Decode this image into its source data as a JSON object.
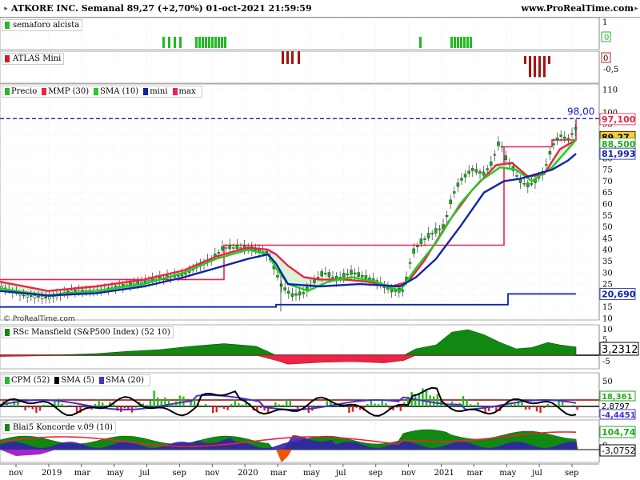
{
  "header": {
    "title": "ATKORE INC. Semanal 89,27 (+2,70%) 01-oct-2021 21:59:59",
    "site": "www.ProRealTime.com"
  },
  "copyright": "© ProRealTime.com",
  "colors": {
    "up": "#22bb22",
    "down": "#cc2222",
    "mmp": "#ee2244",
    "sma": "#22cc22",
    "mini": "#1122aa",
    "max": "#ee2255",
    "bg": "#ffffff"
  },
  "x_axis": [
    "nov",
    "2019",
    "mar",
    "may",
    "jul",
    "sep",
    "nov",
    "2020",
    "mar",
    "may",
    "jul",
    "sep",
    "nov",
    "2021",
    "mar",
    "may",
    "jul",
    "sep"
  ],
  "chart_data": [
    {
      "name": "semaforo",
      "type": "bar",
      "legend": "semaforo alcista",
      "ylim": [
        0,
        1
      ],
      "y_ticks": [
        "1",
        "0"
      ],
      "value_label": "0",
      "green_bars_x": [
        203,
        210,
        217,
        224,
        244,
        248,
        252,
        256,
        260,
        264,
        268,
        272,
        276,
        280,
        524,
        563,
        567,
        571,
        575,
        579,
        583,
        587
      ],
      "red_bars_x": [
        352,
        358,
        364,
        372
      ]
    },
    {
      "name": "atlas",
      "type": "bar",
      "legend": "ATLAS Mini",
      "ylim": [
        -1,
        0
      ],
      "y_ticks": [
        "0",
        "-0,5"
      ],
      "value_label": "0",
      "bars_x": [
        655,
        661,
        667,
        673,
        679,
        685
      ],
      "bars_val": [
        -0.3,
        -0.8,
        -0.8,
        -0.8,
        -0.8,
        -0.3
      ]
    },
    {
      "name": "price",
      "type": "line",
      "legend": [
        {
          "label": "Precio",
          "color": "#22bb22"
        },
        {
          "label": "MMP (30)",
          "color": "#ee2244"
        },
        {
          "label": "SMA (10)",
          "color": "#22cc22"
        },
        {
          "label": "mini",
          "color": "#1122aa"
        },
        {
          "label": "max",
          "color": "#ee2255"
        }
      ],
      "ylim": [
        10,
        110
      ],
      "y_ticks": [
        110,
        100,
        95,
        90,
        85,
        80,
        75,
        70,
        65,
        60,
        55,
        50,
        45,
        40,
        35,
        30,
        25,
        20,
        15,
        10
      ],
      "level_98": "98,00",
      "labels": [
        {
          "text": "97,100",
          "color": "#ee2244",
          "bg": "#ffffff",
          "y": 97.1
        },
        {
          "text": "89,27",
          "color": "#000000",
          "bg": "#ffcc33",
          "y": 89.27
        },
        {
          "text": "88,500",
          "color": "#22aa22",
          "bg": "#ffffff",
          "y": 86.3
        },
        {
          "text": "81,993",
          "color": "#1122aa",
          "bg": "#ffffff",
          "y": 81.99
        },
        {
          "text": "20,690",
          "color": "#1122aa",
          "bg": "#ffffff",
          "y": 20.69
        }
      ],
      "price_x": [
        0,
        30,
        60,
        90,
        120,
        150,
        180,
        210,
        230,
        250,
        265,
        280,
        300,
        320,
        335,
        345,
        352,
        365,
        380,
        395,
        405,
        420,
        440,
        455,
        470,
        490,
        505,
        515,
        525,
        540,
        555,
        565,
        575,
        590,
        605,
        615,
        625,
        632,
        640,
        650,
        660,
        670,
        680,
        690,
        700,
        710,
        720
      ],
      "price_y": [
        24,
        20,
        19,
        22,
        22,
        24,
        26,
        28,
        29,
        33,
        36,
        41,
        41,
        40,
        38,
        30,
        24,
        20,
        21,
        27,
        30,
        27,
        30,
        28,
        26,
        22,
        22,
        38,
        43,
        47,
        50,
        63,
        70,
        75,
        73,
        78,
        88,
        80,
        76,
        70,
        68,
        70,
        74,
        85,
        90,
        88,
        93
      ],
      "mmp_x": [
        0,
        60,
        120,
        180,
        230,
        270,
        310,
        335,
        345,
        360,
        380,
        400,
        430,
        460,
        490,
        510,
        530,
        560,
        590,
        620,
        640,
        660,
        680,
        700,
        720
      ],
      "mmp_y": [
        26,
        22,
        24,
        27,
        31,
        37,
        41,
        40,
        38,
        33,
        28,
        27,
        27,
        26,
        24,
        26,
        35,
        52,
        66,
        77,
        78,
        72,
        73,
        84,
        88
      ],
      "sma_x": [
        0,
        60,
        120,
        180,
        230,
        270,
        310,
        335,
        345,
        360,
        385,
        410,
        440,
        470,
        500,
        520,
        545,
        575,
        600,
        625,
        645,
        665,
        690,
        710,
        720
      ],
      "sma_y": [
        23,
        20,
        22,
        25,
        30,
        36,
        40,
        38,
        32,
        25,
        22,
        26,
        28,
        26,
        22,
        32,
        43,
        60,
        70,
        76,
        75,
        70,
        76,
        84,
        88
      ],
      "mini_x": [
        0,
        60,
        120,
        180,
        230,
        270,
        310,
        335,
        345,
        360,
        400,
        450,
        500,
        520,
        545,
        575,
        605,
        630,
        650,
        670,
        690,
        710,
        720
      ],
      "mini_y": [
        22,
        20,
        21,
        24,
        28,
        32,
        36,
        38,
        34,
        25,
        24,
        25,
        24,
        28,
        36,
        50,
        65,
        70,
        71,
        73,
        75,
        79,
        82
      ],
      "max_steps_x": [
        0,
        60,
        280,
        345,
        630,
        690,
        720
      ],
      "max_steps_y": [
        27,
        27,
        42,
        42,
        85,
        88,
        97
      ],
      "min_steps_x": [
        0,
        60,
        345,
        635,
        720
      ],
      "min_steps_y": [
        15,
        15,
        16,
        20.69,
        20.69
      ]
    },
    {
      "name": "rsc",
      "type": "area",
      "legend": "RSc Mansfield (S&P500 Index) (52 10)",
      "ylim": [
        -5,
        10
      ],
      "y_ticks": [
        "10",
        "5",
        "0",
        "-5"
      ],
      "value_label": "3,2312",
      "x": [
        0,
        40,
        80,
        120,
        160,
        200,
        240,
        280,
        320,
        345,
        360,
        400,
        440,
        480,
        505,
        520,
        545,
        565,
        585,
        605,
        625,
        645,
        665,
        685,
        700,
        720
      ],
      "y": [
        -0.5,
        -0.3,
        0.2,
        0.6,
        1.5,
        2.2,
        3.5,
        4.5,
        3.5,
        -2,
        -3.5,
        -2.8,
        -2.5,
        -3,
        -2,
        2.5,
        4,
        9,
        10,
        8,
        5,
        2.5,
        3,
        5,
        4,
        3.2
      ]
    },
    {
      "name": "cpm",
      "type": "bar",
      "legend": [
        {
          "label": "CPM (52)",
          "color": "#22bb22"
        },
        {
          "label": "SMA (5)",
          "color": "#000000"
        },
        {
          "label": "SMA (20)",
          "color": "#4433cc"
        }
      ],
      "ylim": [
        -20,
        50
      ],
      "y_ticks": [
        "50",
        "25"
      ],
      "value_labels": [
        {
          "text": "18,361",
          "color": "#22aa22"
        },
        {
          "text": "2,8797",
          "color": "#000000"
        },
        {
          "text": "-4,4451",
          "color": "#4433cc"
        }
      ]
    },
    {
      "name": "koncorde",
      "type": "area",
      "legend": "Blai5 Koncorde v.09 (10)",
      "ylim": [
        -50,
        150
      ],
      "y_ticks": [
        "100",
        "0"
      ],
      "value_labels": [
        {
          "text": "104,74",
          "color": "#22aa22"
        },
        {
          "text": "-3,0752",
          "color": "#000000"
        }
      ]
    }
  ]
}
